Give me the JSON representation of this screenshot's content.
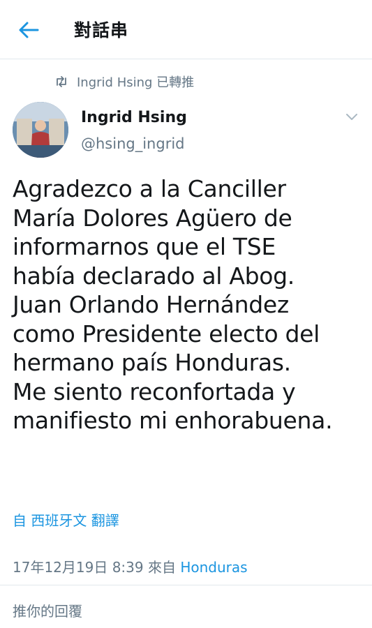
{
  "header": {
    "title": "對話串",
    "back_icon": "arrow-left-icon",
    "accent_color": "#1b95e0"
  },
  "retweet": {
    "icon": "retweet-icon",
    "text": "Ingrid Hsing 已轉推"
  },
  "tweet": {
    "author_name": "Ingrid Hsing",
    "author_handle": "@hsing_ingrid",
    "more_icon": "chevron-down-icon",
    "text": "Agradezco a la Canciller\nMaría Dolores Agüero de\ninformarnos que el TSE\nhabía declarado al Abog.\nJuan Orlando Hernández\ncomo Presidente electo del\nhermano país Honduras.\nMe siento reconfortada y\nmanifiesto mi enhorabuena.",
    "translate_label": "自 西班牙文 翻譯",
    "timestamp": "17年12月19日 8:39 來自 ",
    "source": "Honduras"
  },
  "reply": {
    "placeholder": "推你的回覆"
  }
}
